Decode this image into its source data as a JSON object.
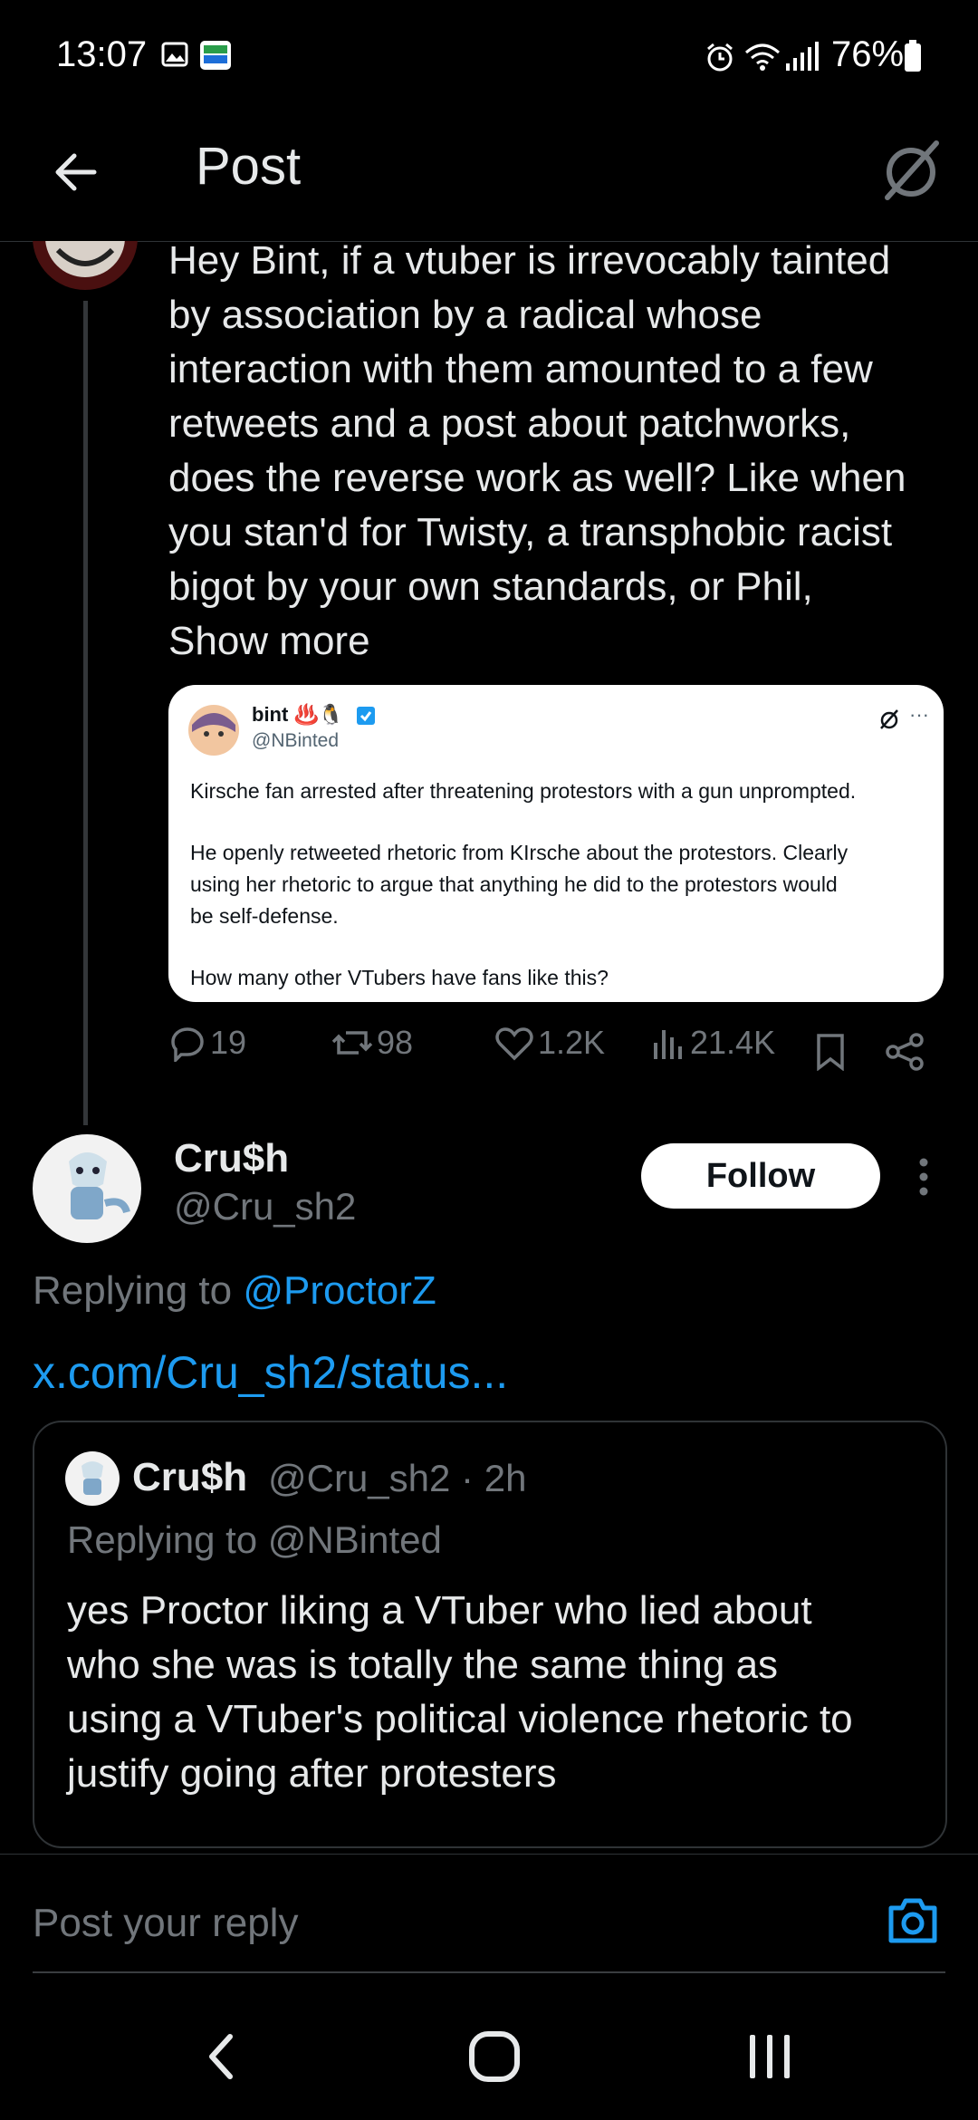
{
  "status_bar": {
    "time": "13:07",
    "battery": "76%"
  },
  "header": {
    "title": "Post"
  },
  "parent_post": {
    "text": "Hey Bint, if a vtuber is irrevocably tainted by association by a radical whose interaction with them amounted to a few retweets and a post about patchworks, does the reverse work as well? Like when you stan'd for Twisty, a transphobic racist bigot by your own standards, or Phil,",
    "show_more": "Show more",
    "lines": [
      "Hey Bint, if a vtuber is irrevocably tainted",
      "by association by a radical whose",
      "interaction with them amounted to a few",
      "retweets and a post about patchworks,",
      "does the reverse work as well? Like when",
      "you stan'd for Twisty, a transphobic racist",
      "bigot by your own standards, or Phil,"
    ],
    "quoted": {
      "name": "bint",
      "emoji": "♨️🐧",
      "handle": "@NBinted",
      "line1": "Kirsche fan arrested after threatening protestors with a gun unprompted.",
      "line2": "He openly retweeted rhetoric from KIrsche about the protestors. Clearly",
      "line3": "using her rhetoric to argue that anything he did to the protestors would",
      "line4": "be self-defense.",
      "line5": "How many other VTubers have fans like this?"
    },
    "stats": {
      "replies": "19",
      "reposts": "98",
      "likes": "1.2K",
      "views": "21.4K"
    }
  },
  "reply_post": {
    "name": "Cru$h",
    "handle": "@Cru_sh2",
    "follow_label": "Follow",
    "replying_prefix": "Replying to ",
    "replying_to": "@ProctorZ",
    "link": "x.com/Cru_sh2/status...",
    "embed": {
      "name": "Cru$h",
      "handle_time": "@Cru_sh2 · 2h",
      "replying": "Replying to @NBinted",
      "lines": [
        "yes Proctor liking a VTuber who lied about",
        "who she was is totally the same thing as",
        "using a VTuber's political violence rhetoric to",
        "justify going after protesters"
      ]
    }
  },
  "composer": {
    "placeholder": "Post your reply"
  },
  "colors": {
    "accent": "#1d9bf0",
    "background": "#000000",
    "muted": "#71767b"
  },
  "icons": [
    "back-arrow-icon",
    "grok-icon",
    "reply-icon",
    "repost-icon",
    "like-icon",
    "views-icon",
    "bookmark-icon",
    "share-icon",
    "more-icon",
    "camera-icon",
    "nav-back-icon",
    "nav-home-icon",
    "nav-recents-icon"
  ]
}
